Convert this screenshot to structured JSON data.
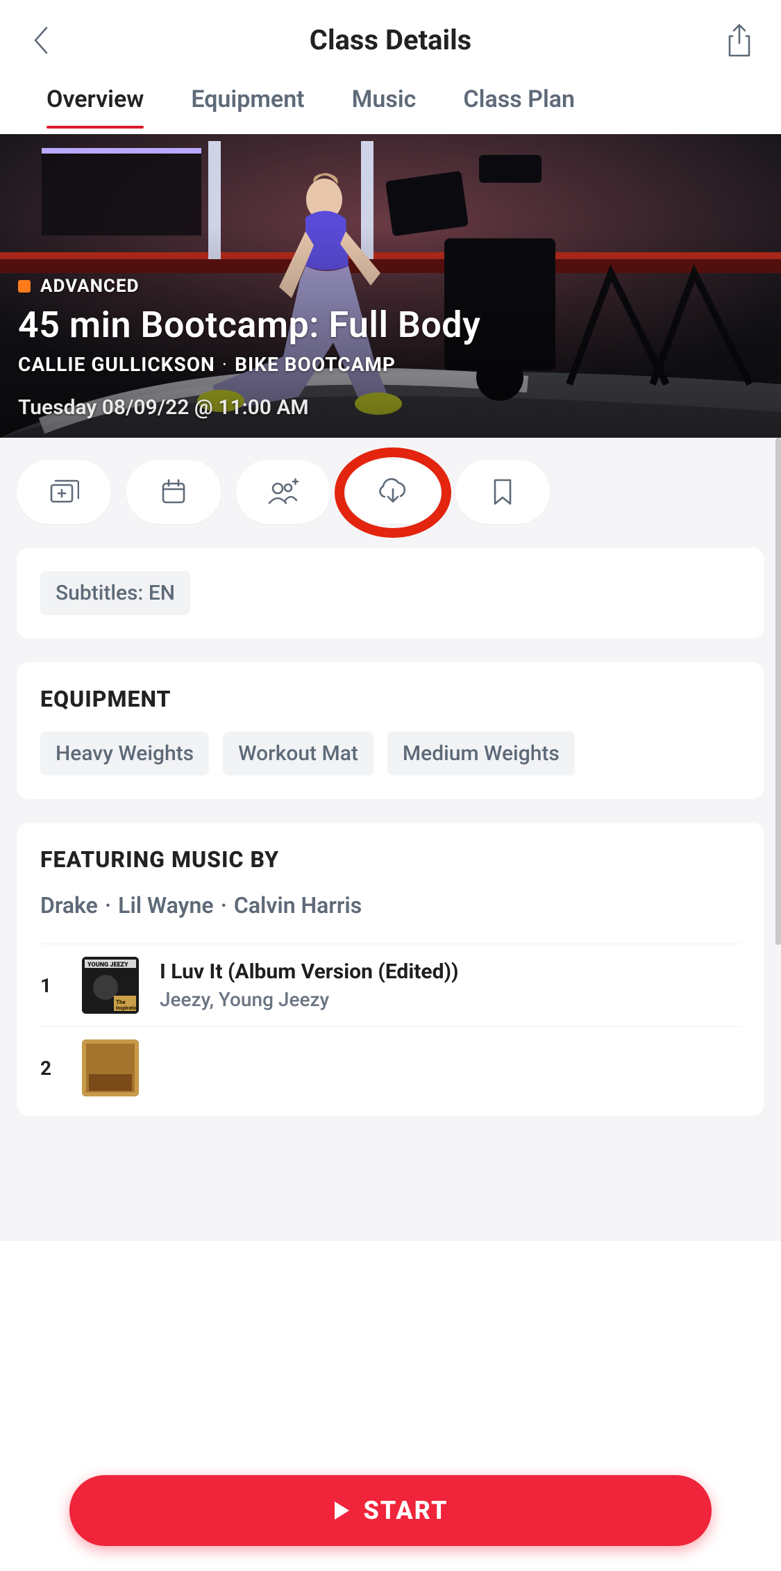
{
  "header": {
    "title": "Class Details"
  },
  "tabs": [
    "Overview",
    "Equipment",
    "Music",
    "Class Plan"
  ],
  "active_tab_index": 0,
  "hero": {
    "level": "ADVANCED",
    "title": "45 min Bootcamp: Full Body",
    "instructor": "CALLIE GULLICKSON",
    "category": "BIKE BOOTCAMP",
    "datetime": "Tuesday 08/09/22 @ 11:00 AM"
  },
  "actions": {
    "stack": "stack-icon",
    "schedule": "calendar-icon",
    "invite": "people-add-icon",
    "download": "download-cloud-icon",
    "bookmark": "bookmark-icon"
  },
  "subtitles_chip": "Subtitles: EN",
  "equipment": {
    "heading": "EQUIPMENT",
    "items": [
      "Heavy Weights",
      "Workout Mat",
      "Medium Weights"
    ]
  },
  "music": {
    "heading": "FEATURING MUSIC BY",
    "artists": [
      "Drake",
      "Lil Wayne",
      "Calvin Harris"
    ],
    "tracks": [
      {
        "n": "1",
        "title": "I Luv It (Album Version (Edited))",
        "artist": "Jeezy, Young Jeezy"
      },
      {
        "n": "2",
        "title": "",
        "artist": ""
      }
    ]
  },
  "start_label": "START"
}
